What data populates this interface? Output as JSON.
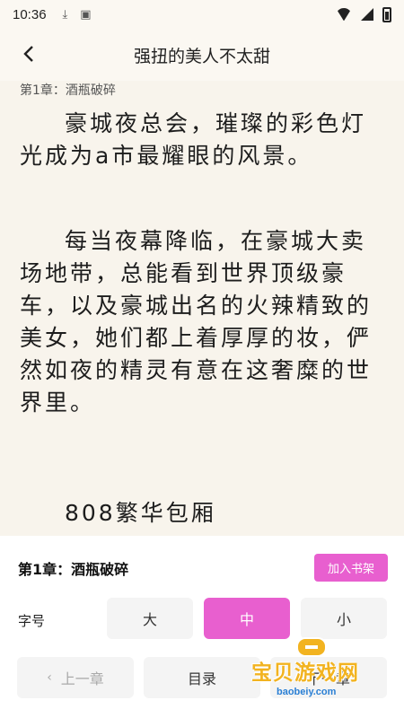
{
  "status_bar": {
    "time": "10:36",
    "icons": [
      "download-icon",
      "a-icon",
      "wifi-icon",
      "signal-icon",
      "battery-icon"
    ]
  },
  "header": {
    "back_icon": "chevron-left-icon",
    "title": "强扭的美人不太甜"
  },
  "content": {
    "chapter_heading": "第1章：酒瓶破碎",
    "paragraphs": [
      "豪城夜总会，璀璨的彩色灯光成为a市最耀眼的风景。",
      "每当夜幕降临，在豪城大卖场地带，总能看到世界顶级豪车，以及豪城出名的火辣精致的美女，她们都上着厚厚的妆，俨然如夜的精灵有意在这奢糜的世界里。",
      "808繁华包厢"
    ]
  },
  "panel": {
    "chapter_label": "第1章：酒瓶破碎",
    "add_shelf_label": "加入书架",
    "font_size_label": "字号",
    "font_sizes": [
      {
        "label": "大",
        "active": false
      },
      {
        "label": "中",
        "active": true
      },
      {
        "label": "小",
        "active": false
      }
    ],
    "prev_label": "上一章",
    "toc_label": "目录",
    "next_label": "下一章"
  },
  "watermark": {
    "text": "宝贝游戏网",
    "url": "baobeiy.com"
  },
  "colors": {
    "accent": "#e85fcf",
    "page_bg": "#f8f4ec",
    "panel_bg": "#ffffff",
    "watermark_yellow": "#f2b320",
    "watermark_blue": "#2a7fd4"
  }
}
